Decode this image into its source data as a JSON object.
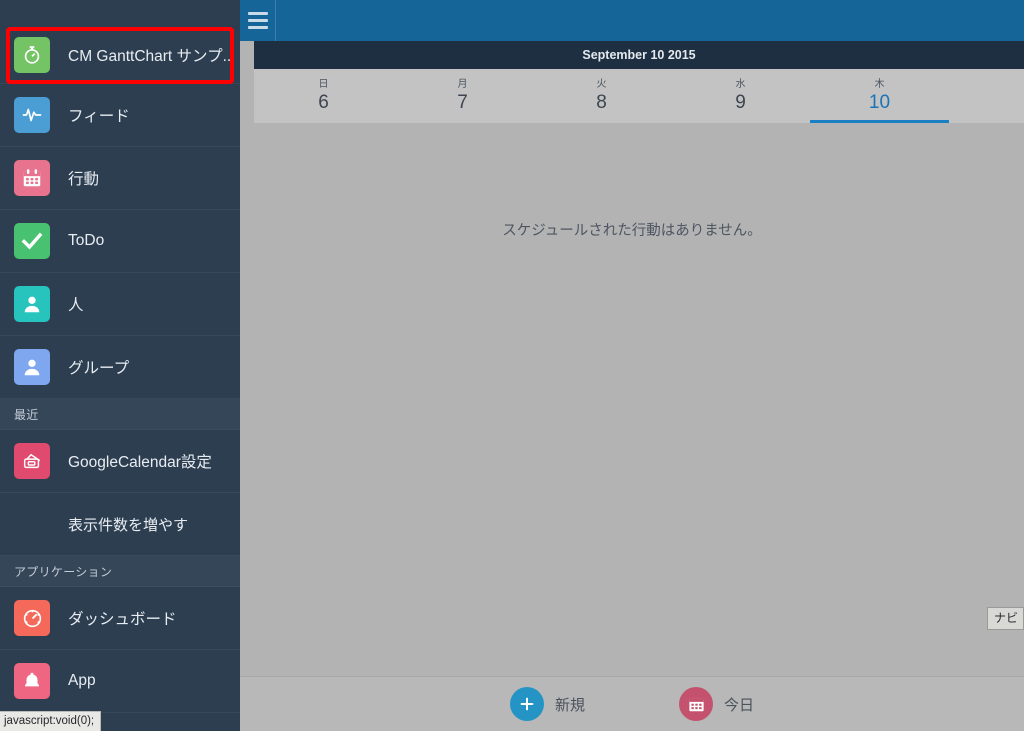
{
  "sidebar": {
    "items": [
      {
        "label": "CM GanttChart サンプ...",
        "icon": "stopwatch-icon",
        "color": "#74c365",
        "type": "app"
      },
      {
        "label": "フィード",
        "icon": "pulse-icon",
        "color": "#4a9ed4",
        "type": "app"
      },
      {
        "label": "行動",
        "icon": "calendar-icon",
        "color": "#e8738f",
        "type": "app"
      },
      {
        "label": "ToDo",
        "icon": "check-icon",
        "color": "#48c171",
        "type": "app"
      },
      {
        "label": "人",
        "icon": "person-icon",
        "color": "#27c4be",
        "type": "app"
      },
      {
        "label": "グループ",
        "icon": "group-icon",
        "color": "#7ea7f0",
        "type": "app"
      }
    ],
    "recent_section": {
      "label": "最近"
    },
    "recent_items": [
      {
        "label": "GoogleCalendar設定",
        "icon": "ticket-icon",
        "color": "#e04a6e"
      }
    ],
    "more_link": {
      "label": "表示件数を増やす"
    },
    "apps_section": {
      "label": "アプリケーション"
    },
    "app_items": [
      {
        "label": "ダッシュボード",
        "icon": "gauge-icon",
        "color": "#f4695a"
      },
      {
        "label": "App",
        "icon": "bell-icon",
        "color": "#ef6682"
      }
    ],
    "highlight_color": "#ff0000"
  },
  "status_bar": {
    "text": "javascript:void(0);"
  },
  "topbar": {
    "menu_icon": "hamburger-icon",
    "accent_color": "#166598"
  },
  "calendar": {
    "month_title": "September 10 2015",
    "days": [
      {
        "dow": "日",
        "num": "6",
        "active": false
      },
      {
        "dow": "月",
        "num": "7",
        "active": false
      },
      {
        "dow": "火",
        "num": "8",
        "active": false
      },
      {
        "dow": "水",
        "num": "9",
        "active": false
      },
      {
        "dow": "木",
        "num": "10",
        "active": true
      },
      {
        "dow": "",
        "num": "",
        "active": false
      }
    ],
    "empty_message": "スケジュールされた行動はありません。",
    "selected_accent": "#1b7fc4"
  },
  "nav_pill": {
    "label": "ナビ"
  },
  "footer": {
    "buttons": [
      {
        "label": "新規",
        "icon": "plus-icon",
        "color": "#2494c4"
      },
      {
        "label": "今日",
        "icon": "calendar-today-icon",
        "color": "#c4526e"
      }
    ]
  }
}
